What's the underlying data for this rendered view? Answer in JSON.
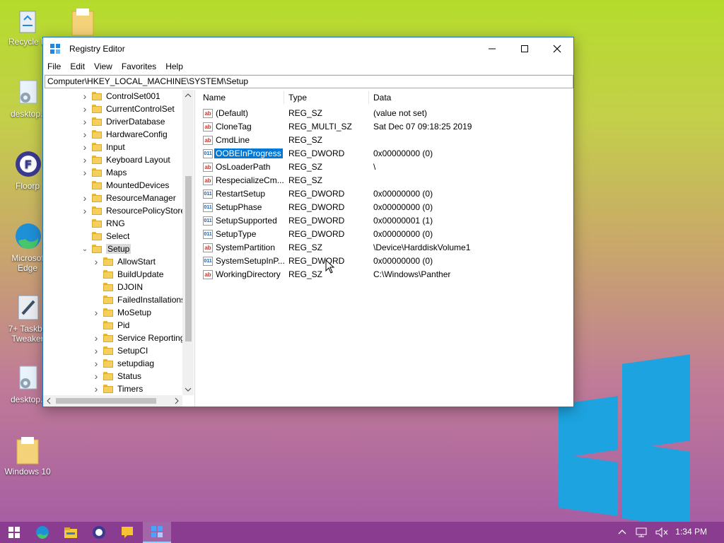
{
  "desktop": {
    "icons": [
      {
        "label": "Recycle B",
        "icon": "recycle-bin-icon"
      },
      {
        "label": "desktop.i",
        "icon": "settings-file-icon"
      },
      {
        "label": "Floorp",
        "icon": "floorp-browser-icon"
      },
      {
        "label": "Microsof Edge",
        "icon": "edge-browser-icon"
      },
      {
        "label": "7+ Taskba Tweaker",
        "icon": "taskbar-tweaker-icon"
      },
      {
        "label": "desktop.i",
        "icon": "settings-file-icon"
      },
      {
        "label": "Windows 10",
        "icon": "folder-icon"
      }
    ]
  },
  "window": {
    "title": "Registry Editor",
    "menu": [
      "File",
      "Edit",
      "View",
      "Favorites",
      "Help"
    ],
    "address": "Computer\\HKEY_LOCAL_MACHINE\\SYSTEM\\Setup",
    "tree": [
      {
        "label": "ControlSet001",
        "indent": 0,
        "expander": "collapsed"
      },
      {
        "label": "CurrentControlSet",
        "indent": 0,
        "expander": "collapsed"
      },
      {
        "label": "DriverDatabase",
        "indent": 0,
        "expander": "collapsed"
      },
      {
        "label": "HardwareConfig",
        "indent": 0,
        "expander": "collapsed"
      },
      {
        "label": "Input",
        "indent": 0,
        "expander": "collapsed"
      },
      {
        "label": "Keyboard Layout",
        "indent": 0,
        "expander": "collapsed"
      },
      {
        "label": "Maps",
        "indent": 0,
        "expander": "collapsed"
      },
      {
        "label": "MountedDevices",
        "indent": 0,
        "expander": "none"
      },
      {
        "label": "ResourceManager",
        "indent": 0,
        "expander": "collapsed"
      },
      {
        "label": "ResourcePolicyStore",
        "indent": 0,
        "expander": "collapsed"
      },
      {
        "label": "RNG",
        "indent": 0,
        "expander": "none"
      },
      {
        "label": "Select",
        "indent": 0,
        "expander": "none"
      },
      {
        "label": "Setup",
        "indent": 0,
        "expander": "expanded",
        "selected": true
      },
      {
        "label": "AllowStart",
        "indent": 1,
        "expander": "collapsed"
      },
      {
        "label": "BuildUpdate",
        "indent": 1,
        "expander": "none"
      },
      {
        "label": "DJOIN",
        "indent": 1,
        "expander": "none"
      },
      {
        "label": "FailedInstallations",
        "indent": 1,
        "expander": "none"
      },
      {
        "label": "MoSetup",
        "indent": 1,
        "expander": "collapsed"
      },
      {
        "label": "Pid",
        "indent": 1,
        "expander": "none"
      },
      {
        "label": "Service Reporting",
        "indent": 1,
        "expander": "collapsed"
      },
      {
        "label": "SetupCI",
        "indent": 1,
        "expander": "collapsed"
      },
      {
        "label": "setupdiag",
        "indent": 1,
        "expander": "collapsed"
      },
      {
        "label": "Status",
        "indent": 1,
        "expander": "collapsed"
      },
      {
        "label": "Timers",
        "indent": 1,
        "expander": "collapsed"
      }
    ],
    "columns": {
      "name": "Name",
      "type": "Type",
      "data": "Data"
    },
    "values": [
      {
        "name": "(Default)",
        "type": "REG_SZ",
        "data": "(value not set)",
        "kind": "sz"
      },
      {
        "name": "CloneTag",
        "type": "REG_MULTI_SZ",
        "data": "Sat Dec 07 09:18:25 2019",
        "kind": "sz"
      },
      {
        "name": "CmdLine",
        "type": "REG_SZ",
        "data": "",
        "kind": "sz"
      },
      {
        "name": "OOBEInProgress",
        "type": "REG_DWORD",
        "data": "0x00000000 (0)",
        "kind": "dw",
        "selected": true
      },
      {
        "name": "OsLoaderPath",
        "type": "REG_SZ",
        "data": "\\",
        "kind": "sz"
      },
      {
        "name": "RespecializeCm...",
        "type": "REG_SZ",
        "data": "",
        "kind": "sz"
      },
      {
        "name": "RestartSetup",
        "type": "REG_DWORD",
        "data": "0x00000000 (0)",
        "kind": "dw"
      },
      {
        "name": "SetupPhase",
        "type": "REG_DWORD",
        "data": "0x00000000 (0)",
        "kind": "dw"
      },
      {
        "name": "SetupSupported",
        "type": "REG_DWORD",
        "data": "0x00000001 (1)",
        "kind": "dw"
      },
      {
        "name": "SetupType",
        "type": "REG_DWORD",
        "data": "0x00000000 (0)",
        "kind": "dw"
      },
      {
        "name": "SystemPartition",
        "type": "REG_SZ",
        "data": "\\Device\\HarddiskVolume1",
        "kind": "sz"
      },
      {
        "name": "SystemSetupInP...",
        "type": "REG_DWORD",
        "data": "0x00000000 (0)",
        "kind": "dw"
      },
      {
        "name": "WorkingDirectory",
        "type": "REG_SZ",
        "data": "C:\\Windows\\Panther",
        "kind": "sz"
      }
    ]
  },
  "taskbar": {
    "apps": [
      "start-icon",
      "edge-icon",
      "file-explorer-icon",
      "floorp-icon",
      "sticky-app-icon",
      "registry-editor-icon"
    ],
    "tray": [
      "chevron-up-icon",
      "network-icon",
      "volume-muted-icon"
    ],
    "clock": "1:34 PM"
  },
  "colors": {
    "accent": "#0078d7",
    "taskbar": "#8a3c91",
    "window_border": "#1a73c8"
  }
}
